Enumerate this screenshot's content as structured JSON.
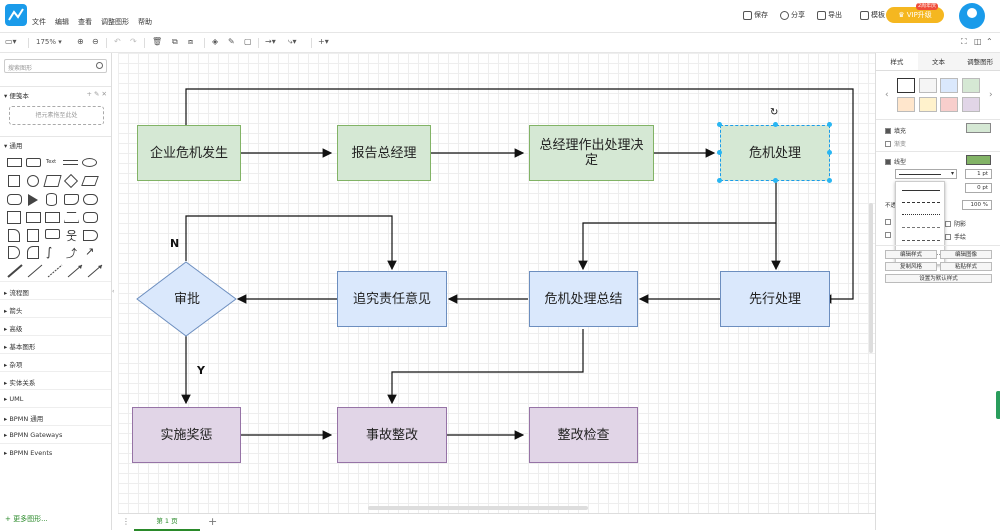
{
  "menu": [
    "文件",
    "编辑",
    "查看",
    "调整图形",
    "帮助"
  ],
  "header_actions": {
    "save": "保存",
    "share": "分享",
    "export": "导出",
    "template": "模板"
  },
  "vip": {
    "label": "VIP升级",
    "badge": "2周年庆"
  },
  "toolbar": {
    "zoom": "175%"
  },
  "left": {
    "search_placeholder": "搜索图形",
    "scratchpad": "便笺本",
    "drop_hint": "把元素拖至此处",
    "general": "通用",
    "text_shape": "Text",
    "categories": [
      "流程图",
      "箭头",
      "高级",
      "基本图形",
      "杂项",
      "实体关系",
      "UML",
      "BPMN 通用",
      "BPMN Gateways",
      "BPMN Events"
    ],
    "more_shapes": "+ 更多图形..."
  },
  "nodes": {
    "n1": "企业危机发生",
    "n2": "报告总经理",
    "n3": "总经理作出处理决定",
    "n4": "危机处理",
    "n5": "先行处理",
    "n6": "危机处理总结",
    "n7": "追究责任意见",
    "n8": "审批",
    "n9": "实施奖惩",
    "n10": "事故整改",
    "n11": "整改检查"
  },
  "edge_labels": {
    "no": "N",
    "yes": "Y"
  },
  "page_tab": "第 1 页",
  "right": {
    "tabs": [
      "样式",
      "文本",
      "调整图形"
    ],
    "fill": "填充",
    "gradient": "渐变",
    "line": "线型",
    "line_width": "1 pt",
    "spacing": "0 pt",
    "opacity_label": "不透明度",
    "opacity": "100 %",
    "shadow": "阴影",
    "sketch": "手绘",
    "buttons": [
      "编辑样式",
      "编辑图像",
      "复制风格",
      "粘贴样式",
      "设置为默认样式"
    ],
    "swatch_colors": [
      "#ffffff",
      "#f5f5f5",
      "#dae8fc",
      "#d5e8d4",
      "#ffe6cc",
      "#fff2cc",
      "#f8cecc",
      "#e1d5e7"
    ]
  }
}
